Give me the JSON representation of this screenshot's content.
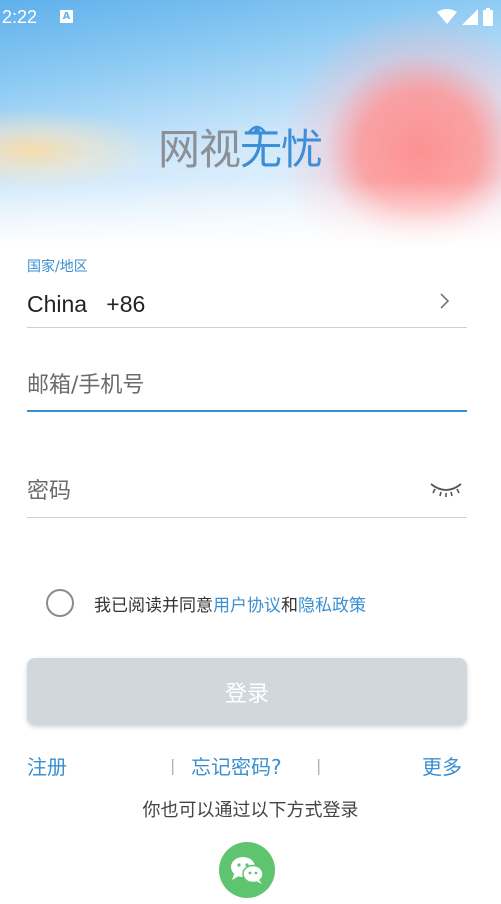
{
  "status_bar": {
    "time": "2:22",
    "notification_icon": "app-notification-icon",
    "icons": [
      "wifi-icon",
      "signal-icon",
      "battery-icon"
    ]
  },
  "logo": {
    "part1": "网视",
    "part2": "无忧"
  },
  "country": {
    "label": "国家/地区",
    "value": "China   +86",
    "icon": "chevron-right-icon"
  },
  "email": {
    "placeholder": "邮箱/手机号",
    "value": ""
  },
  "password": {
    "placeholder": "密码",
    "value": "",
    "toggle_icon": "eye-closed-icon"
  },
  "agreement": {
    "prefix": "我已阅读并同意",
    "terms": "用户协议",
    "and": "和",
    "privacy": "隐私政策"
  },
  "login_button": {
    "label": "登录"
  },
  "links": {
    "register": "注册",
    "forgot": "忘记密码?",
    "more": "更多",
    "separator": "|"
  },
  "alt_login": {
    "text": "你也可以通过以下方式登录",
    "wechat_icon": "wechat-icon"
  },
  "colors": {
    "accent": "#3a8fd0",
    "button_disabled": "#d0d8de",
    "wechat": "#5fc46f"
  }
}
